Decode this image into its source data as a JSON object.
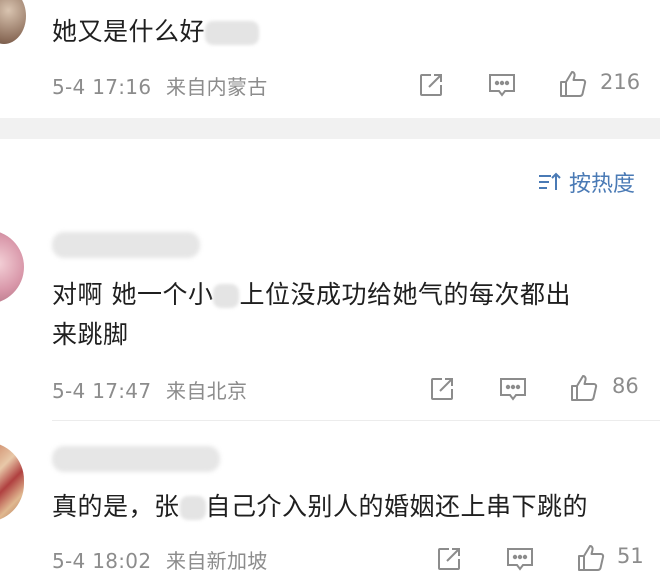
{
  "comments": [
    {
      "text_before": "她又是什么好",
      "text_after": "",
      "timestamp": "5-4 17:16",
      "location": "来自内蒙古",
      "likes": "216"
    },
    {
      "text_line1_before": "对啊 她一个小",
      "text_line1_after": "上位没成功给她气的每次都出",
      "text_line2": "来跳脚",
      "timestamp": "5-4 17:47",
      "location": "来自北京",
      "likes": "86"
    },
    {
      "text_before": "真的是，张",
      "text_after": "自己介入别人的婚姻还上串下跳的",
      "timestamp": "5-4 18:02",
      "location": "来自新加坡",
      "likes": "51"
    }
  ],
  "sort": {
    "label": "按热度"
  },
  "icons": {
    "share": "share-icon",
    "comment": "comment-icon",
    "like": "thumbs-up-icon",
    "sort": "sort-icon"
  },
  "colors": {
    "accent": "#4a7ab5",
    "meta": "#8c8c8c",
    "band": "#f1f1f1"
  }
}
